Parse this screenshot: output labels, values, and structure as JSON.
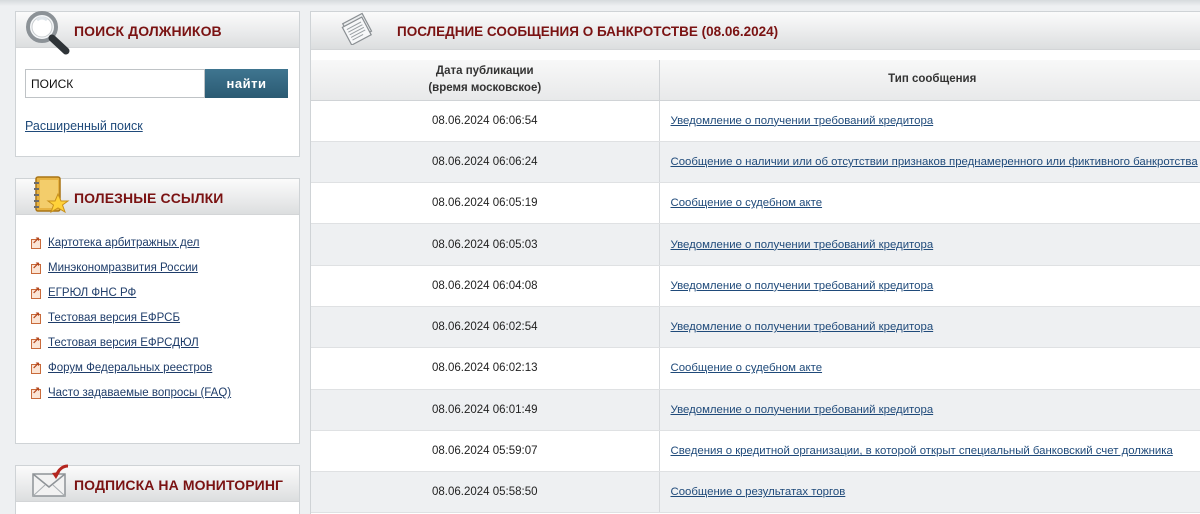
{
  "search_box": {
    "title": "ПОИСК ДОЛЖНИКОВ",
    "input_value": "ПОИСК",
    "button_label": "найти",
    "advanced_link": "Расширенный поиск"
  },
  "links_box": {
    "title": "ПОЛЕЗНЫЕ ССЫЛКИ",
    "items": [
      {
        "label": "Картотека арбитражных дел"
      },
      {
        "label": "Минэкономразвития России"
      },
      {
        "label": "ЕГРЮЛ ФНС РФ"
      },
      {
        "label": "Тестовая версия ЕФРСБ"
      },
      {
        "label": "Тестовая версия ЕФРСДЮЛ"
      },
      {
        "label": "Форум Федеральных реестров"
      },
      {
        "label": "Часто задаваемые вопросы (FAQ)"
      }
    ]
  },
  "subscribe_box": {
    "title": "ПОДПИСКА НА МОНИТОРИНГ"
  },
  "messages": {
    "title": "ПОСЛЕДНИЕ СООБЩЕНИЯ О БАНКРОТСТВЕ (08.06.2024)",
    "col_date_line1": "Дата публикации",
    "col_date_line2": "(время московское)",
    "col_type": "Тип сообщения",
    "rows": [
      {
        "date": "08.06.2024 06:06:54",
        "type": "Уведомление о получении требований кредитора"
      },
      {
        "date": "08.06.2024 06:06:24",
        "type": "Сообщение о наличии или об отсутствии признаков преднамеренного или фиктивного банкротства"
      },
      {
        "date": "08.06.2024 06:05:19",
        "type": "Сообщение о судебном акте"
      },
      {
        "date": "08.06.2024 06:05:03",
        "type": "Уведомление о получении требований кредитора"
      },
      {
        "date": "08.06.2024 06:04:08",
        "type": "Уведомление о получении требований кредитора"
      },
      {
        "date": "08.06.2024 06:02:54",
        "type": "Уведомление о получении требований кредитора"
      },
      {
        "date": "08.06.2024 06:02:13",
        "type": "Сообщение о судебном акте"
      },
      {
        "date": "08.06.2024 06:01:49",
        "type": "Уведомление о получении требований кредитора"
      },
      {
        "date": "08.06.2024 05:59:07",
        "type": "Сведения о кредитной организации, в которой открыт специальный банковский счет должника"
      },
      {
        "date": "08.06.2024 05:58:50",
        "type": "Сообщение о результатах торгов"
      }
    ]
  },
  "colors": {
    "title_red": "#7a1212",
    "link_blue": "#1f4a7a",
    "button_blue": "#2f6580"
  }
}
